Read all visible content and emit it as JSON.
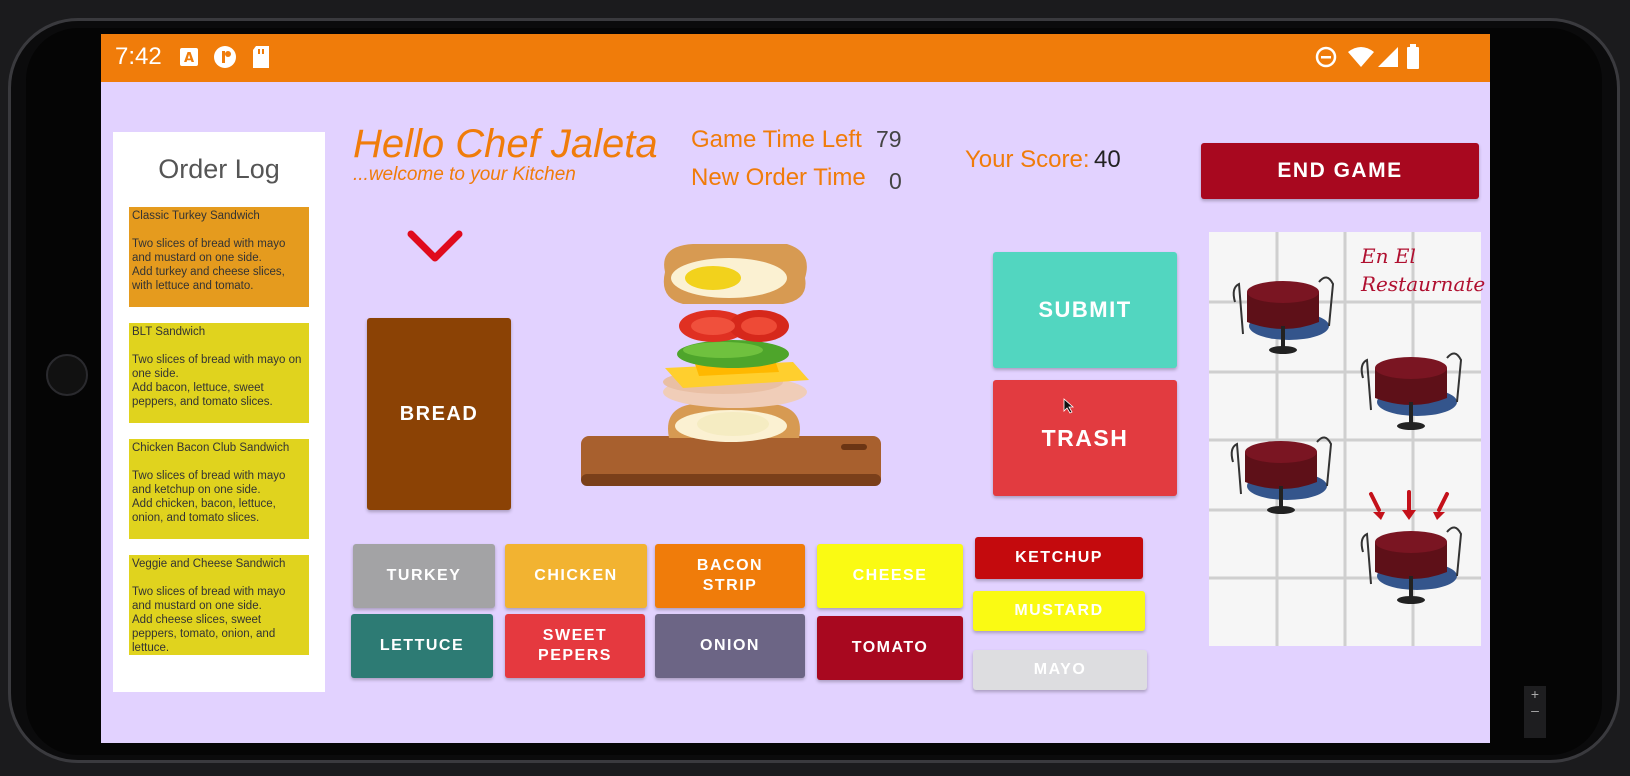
{
  "status_bar": {
    "time": "7:42",
    "left_icons": [
      "a-box-icon",
      "podcast-icon",
      "sd-card-icon"
    ],
    "right_icons": [
      "do-not-disturb-icon",
      "wifi-icon",
      "signal-icon",
      "battery-icon"
    ]
  },
  "order_log": {
    "title": "Order Log",
    "orders": [
      {
        "name": "Classic Turkey Sandwich",
        "description": "Two slices of bread with mayo and mustard on one side.\nAdd turkey and cheese slices, with lettuce and tomato.",
        "color": "#e59b1e"
      },
      {
        "name": "BLT Sandwich",
        "description": "Two slices of bread with mayo on one side.\nAdd bacon, lettuce, sweet peppers, and tomato slices.",
        "color": "#e0d31e"
      },
      {
        "name": "Chicken Bacon Club Sandwich",
        "description": "Two slices of bread with mayo and ketchup on one side.\nAdd chicken, bacon, lettuce, onion, and tomato slices.",
        "color": "#e0d31e"
      },
      {
        "name": "Veggie and Cheese Sandwich",
        "description": "Two slices of bread with mayo and mustard on one side.\nAdd cheese slices, sweet peppers, tomato, onion, and lettuce.",
        "color": "#e0d31e"
      }
    ]
  },
  "header": {
    "greeting": "Hello Chef Jaleta",
    "welcome": "...welcome to your Kitchen"
  },
  "stats": {
    "game_time_label": "Game Time Left",
    "game_time_value": "79",
    "new_order_label": "New Order Time",
    "new_order_value": "0",
    "score_label": "Your Score:",
    "score_value": "40"
  },
  "buttons": {
    "end_game": "END GAME",
    "bread": "BREAD",
    "submit": "SUBMIT",
    "trash": "TRASH"
  },
  "ingredients": {
    "turkey": "TURKEY",
    "chicken": "CHICKEN",
    "bacon": "BACON STRIP",
    "cheese": "CHEESE",
    "lettuce": "LETTUCE",
    "sweet_peppers": "SWEET PEPERS",
    "onion": "ONION",
    "tomato": "TOMATO",
    "ketchup": "KETCHUP",
    "mustard": "MUSTARD",
    "mayo": "MAYO"
  },
  "restaurant": {
    "title": "En El Restaurnate"
  },
  "colors": {
    "accent": "#f07c0a",
    "background": "#e2d2ff",
    "end_game": "#a8081f"
  }
}
